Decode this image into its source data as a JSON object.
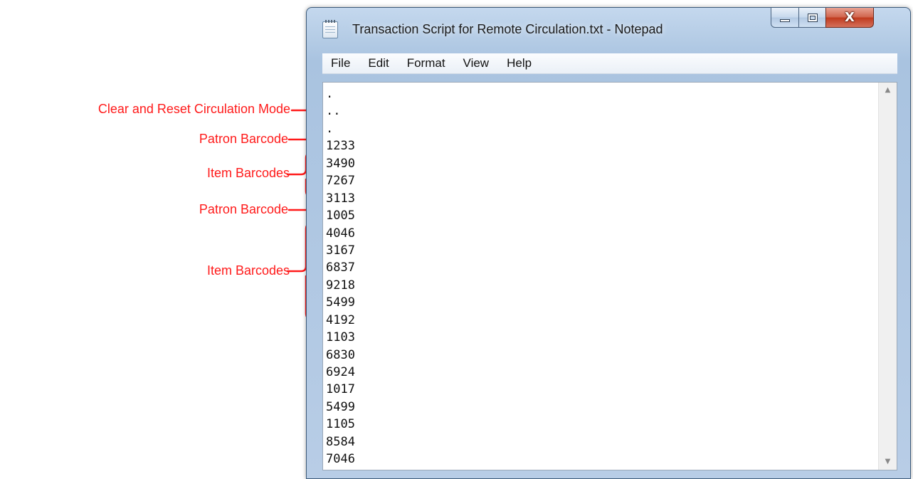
{
  "window": {
    "title": "Transaction Script for Remote Circulation.txt - Notepad",
    "icon": "notepad-icon",
    "controls": {
      "minimize_icon": "minimize-icon",
      "maximize_icon": "maximize-icon",
      "close_icon": "close-icon",
      "close_glyph": "X"
    }
  },
  "menu": {
    "items": [
      "File",
      "Edit",
      "Format",
      "View",
      "Help"
    ]
  },
  "editor": {
    "lines": [
      ".",
      "..",
      ".",
      "1233",
      "3490",
      "7267",
      "3113",
      "1005",
      "4046",
      "3167",
      "6837",
      "9218",
      "5499",
      "4192",
      "1103",
      "6830",
      "6924",
      "1017",
      "5499",
      "1105",
      "8584",
      "7046"
    ],
    "scroll_up_glyph": "▲",
    "scroll_down_glyph": "▼"
  },
  "annotations": {
    "clear_reset": "Clear and Reset Circulation Mode",
    "patron_1": "Patron Barcode",
    "items_1": "Item Barcodes",
    "patron_2": "Patron Barcode",
    "items_2": "Item Barcodes",
    "color": "#ff1a1a"
  }
}
